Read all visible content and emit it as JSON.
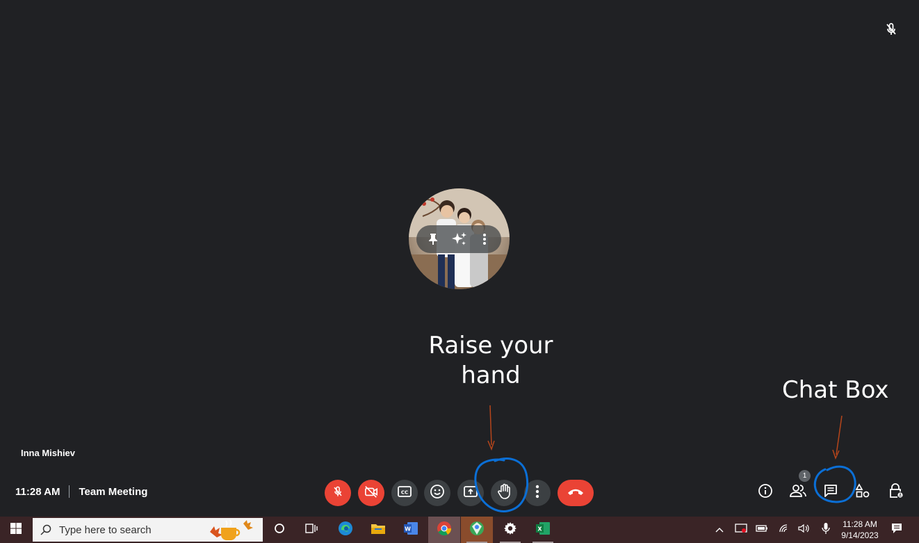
{
  "participant": {
    "name": "Inna Mishiev",
    "muted_icon": "mic-off-icon",
    "tile_actions": [
      "pin-icon",
      "visual-effects-icon",
      "more-options-icon"
    ]
  },
  "meeting": {
    "time": "11:28 AM",
    "title": "Team Meeting"
  },
  "annotations": {
    "raise_hand_line1": "Raise your",
    "raise_hand_line2": "hand",
    "chat_box": "Chat Box",
    "arrow_color": "#b5451b",
    "circle_color": "#0b6fd6"
  },
  "controls": [
    {
      "name": "mic-off-icon",
      "state": "off"
    },
    {
      "name": "camera-off-icon",
      "state": "off"
    },
    {
      "name": "captions-icon"
    },
    {
      "name": "emoji-reaction-icon"
    },
    {
      "name": "present-screen-icon"
    },
    {
      "name": "raise-hand-icon"
    },
    {
      "name": "more-options-icon"
    },
    {
      "name": "hang-up-icon"
    }
  ],
  "side_controls": {
    "info": "info-icon",
    "people": "people-icon",
    "people_count": "1",
    "chat": "chat-icon",
    "activities": "activities-icon",
    "host_controls": "host-controls-lock-icon"
  },
  "taskbar": {
    "search_placeholder": "Type here to search",
    "apps": [
      "cortana-icon",
      "task-view-icon",
      "edge-icon",
      "file-explorer-icon",
      "word-icon",
      "chrome-icon",
      "maps-app-icon",
      "settings-icon",
      "excel-icon"
    ],
    "clock_time": "11:28 AM",
    "clock_date": "9/14/2023"
  },
  "colors": {
    "background": "#202124",
    "control_gray": "#3c4043",
    "control_red": "#ea4335",
    "taskbar": "#3a2426"
  }
}
